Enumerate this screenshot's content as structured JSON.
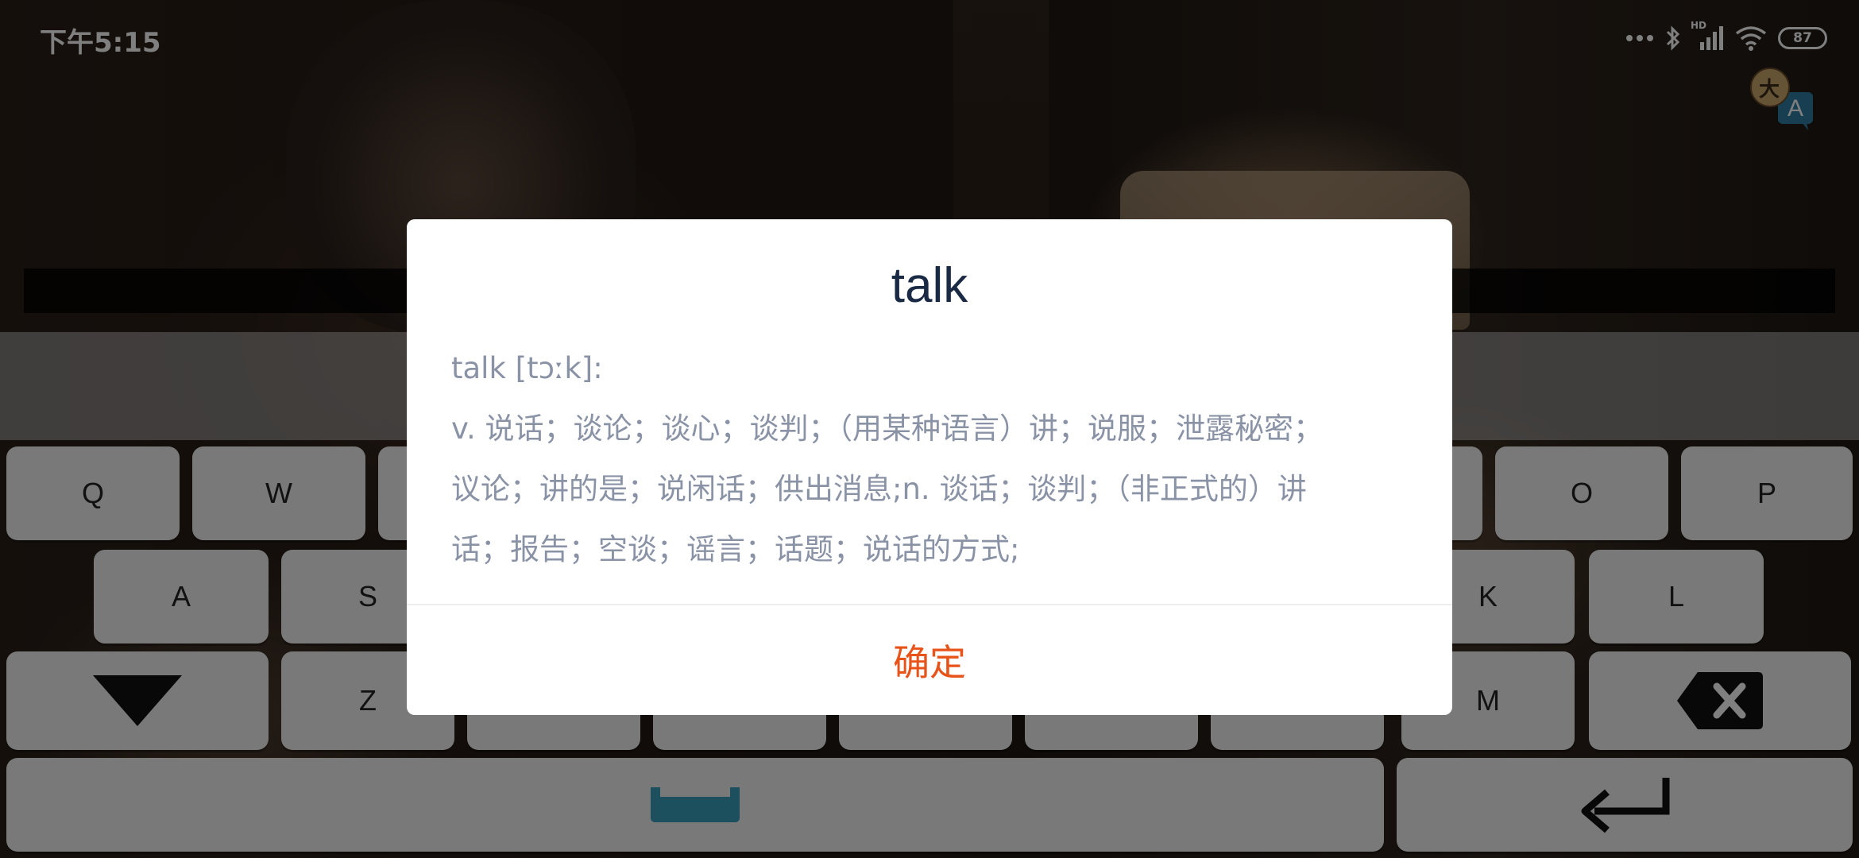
{
  "status_bar": {
    "time": "下午5:15",
    "network_badge": "HD",
    "battery_level": "87",
    "icons": [
      "more-dots-icon",
      "bluetooth-icon",
      "signal-icon",
      "wifi-icon",
      "battery-icon"
    ]
  },
  "translate_fab": {
    "icon": "translate-icon",
    "glyph_cn": "大",
    "glyph_en": "A"
  },
  "keyboard": {
    "row1": [
      "Q",
      "W",
      "",
      "",
      "",
      "",
      "",
      "",
      "O",
      "P"
    ],
    "row2": [
      "A",
      "S",
      "",
      "",
      "",
      "",
      "",
      "K",
      "L"
    ],
    "row3": [
      "",
      "Z",
      "",
      "",
      "",
      "",
      "",
      "M",
      ""
    ],
    "hide_key_icon": "triangle-down-icon",
    "backspace_icon": "backspace-icon",
    "space_icon": "space-icon",
    "enter_icon": "enter-icon",
    "accent_color": "#3aa0bf"
  },
  "dialog": {
    "title": "talk",
    "phonetic_line": "talk  [tɔːk]:",
    "definition_line1": "v. 说话；谈论；谈心；谈判；（用某种语言）讲；说服；泄露秘密；",
    "definition_line2": "议论；讲的是；说闲话；供出消息;n. 谈话；谈判；（非正式的）讲",
    "definition_line3": "话；报告；空谈；谣言；话题；说话的方式;",
    "confirm_label": "确定",
    "confirm_color": "#e8531a",
    "title_color": "#1a2a44"
  }
}
